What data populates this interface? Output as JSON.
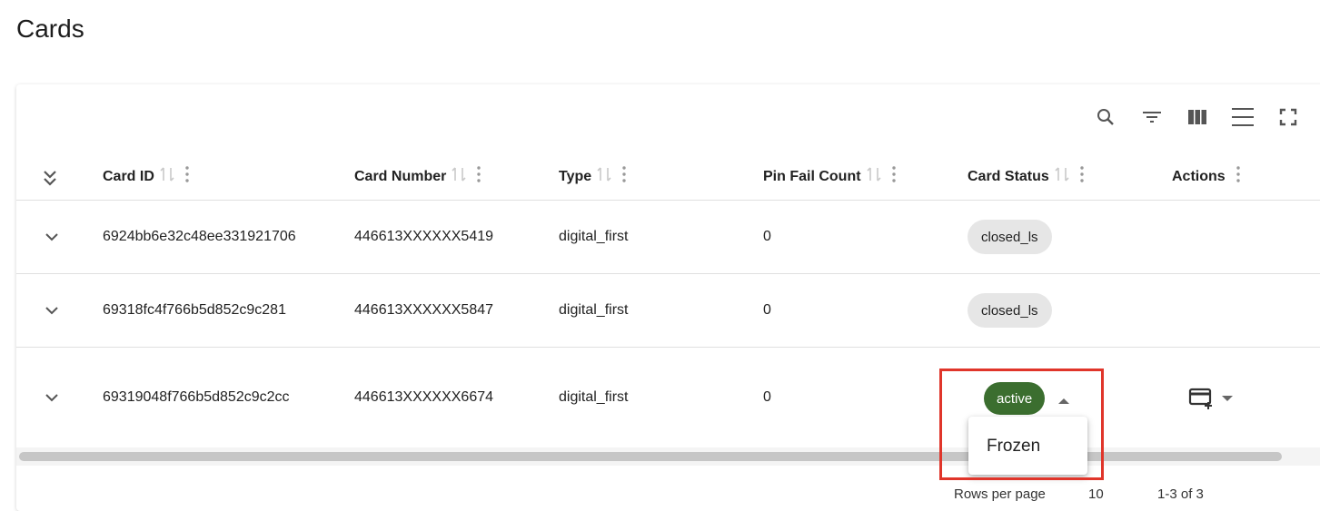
{
  "page": {
    "title": "Cards"
  },
  "toolbar": {
    "icons": [
      "search-icon",
      "filter-icon",
      "columns-icon",
      "density-icon",
      "fullscreen-icon"
    ]
  },
  "table": {
    "columns": [
      {
        "label": "Card ID",
        "sortable": true
      },
      {
        "label": "Card Number",
        "sortable": true
      },
      {
        "label": "Type",
        "sortable": true
      },
      {
        "label": "Pin Fail Count",
        "sortable": true
      },
      {
        "label": "Card Status",
        "sortable": true
      },
      {
        "label": "Actions",
        "sortable": false
      }
    ],
    "rows": [
      {
        "card_id": "6924bb6e32c48ee331921706",
        "card_number": "446613XXXXXX5419",
        "type": "digital_first",
        "pin_fail_count": "0",
        "status": "closed_ls"
      },
      {
        "card_id": "69318fc4f766b5d852c9c281",
        "card_number": "446613XXXXXX5847",
        "type": "digital_first",
        "pin_fail_count": "0",
        "status": "closed_ls"
      },
      {
        "card_id": "69319048f766b5d852c9c2cc",
        "card_number": "446613XXXXXX6674",
        "type": "digital_first",
        "pin_fail_count": "0",
        "status": "active"
      }
    ]
  },
  "status_menu": {
    "options": [
      "Frozen"
    ]
  },
  "pagination": {
    "rows_per_page_label": "Rows per page",
    "rows_per_page_value": "10",
    "range": "1-3 of 3"
  },
  "colors": {
    "active_chip": "#3b6e2f",
    "closed_chip": "#e6e6e6",
    "highlight_border": "#e0352a"
  }
}
